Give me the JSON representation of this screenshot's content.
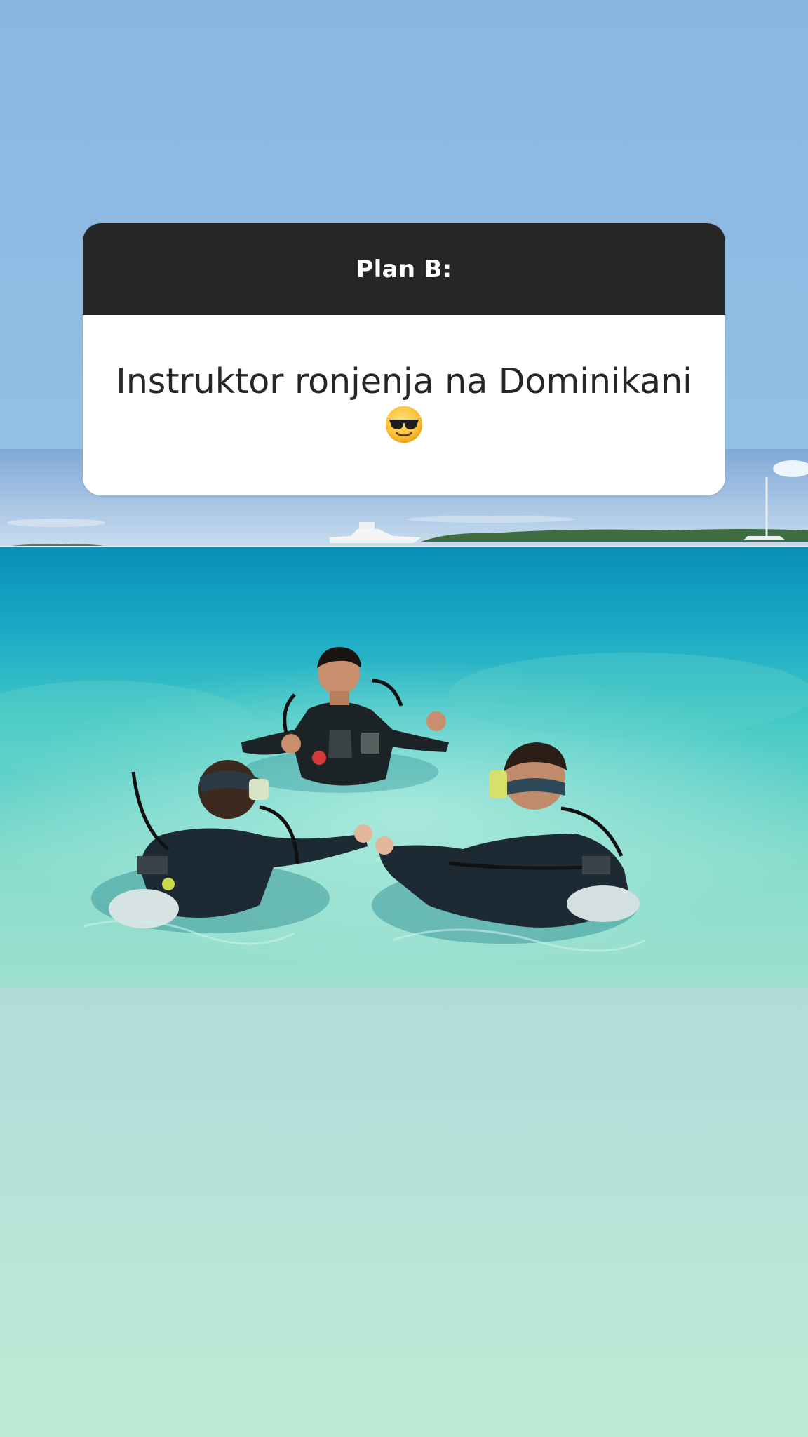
{
  "story": {
    "question": {
      "title": "Plan B:",
      "answer": "Instruktor ronjenja na Dominikani",
      "emoji_icon": "smiling-face-with-sunglasses-icon"
    },
    "photo": {
      "subject": "scuba-diving-lesson-photo"
    },
    "colors": {
      "header_bg": "#262626",
      "card_bg": "#ffffff",
      "sky_top": "#8ab6e3",
      "bottom_gradient": "#bfead5"
    }
  }
}
